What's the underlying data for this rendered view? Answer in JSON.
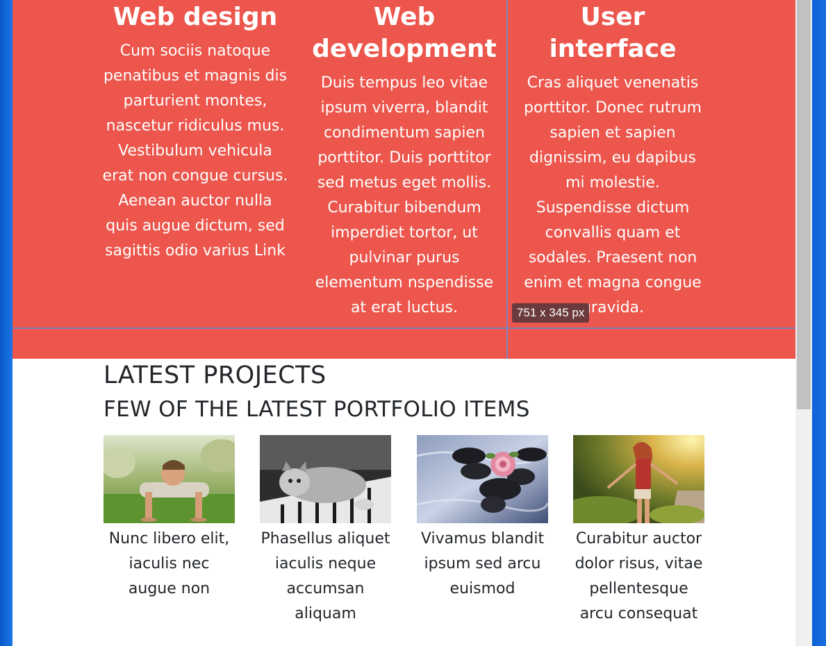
{
  "services": [
    {
      "title": "Web design",
      "text": "Cum sociis natoque penatibus et magnis dis parturient montes, nascetur ridiculus mus. Vestibulum vehicula erat non congue cursus. Aenean auctor nulla quis augue dictum, sed sagittis odio varius Link"
    },
    {
      "title": "Web development",
      "text": "Duis tempus leo vitae ipsum viverra, blandit condimentum sapien porttitor. Duis porttitor sed metus eget mollis. Curabitur bibendum imperdiet tortor, ut pulvinar purus elementum nspendisse at erat luctus."
    },
    {
      "title": "User interface",
      "text": "Cras aliquet venenatis porttitor. Donec rutrum sapien et sapien dignissim, eu dapibus mi molestie. Suspendisse dictum convallis quam et sodales. Praesent non enim et magna congue gravida."
    }
  ],
  "size_badge": "751 x 345 px",
  "projects": {
    "heading": "LATEST PROJECTS",
    "subheading": "FEW OF THE LATEST PORTFOLIO ITEMS",
    "items": [
      {
        "caption": "Nunc libero elit, iaculis nec augue non",
        "image": "man-doing-pushups-photo"
      },
      {
        "caption": "Phasellus aliquet iaculis neque accumsan aliquam",
        "image": "kitten-on-piano-photo"
      },
      {
        "caption": "Vivamus blandit ipsum sed arcu euismod",
        "image": "rose-on-stones-photo"
      },
      {
        "caption": "Curabitur auctor dolor risus, vitae pellentesque arcu consequat",
        "image": "woman-in-sunlight-photo"
      }
    ]
  },
  "colors": {
    "services_bg": "#ec564c",
    "guide_line": "#6c8ccc",
    "heading_text": "#212529",
    "desktop_bg": "#1467d8"
  }
}
